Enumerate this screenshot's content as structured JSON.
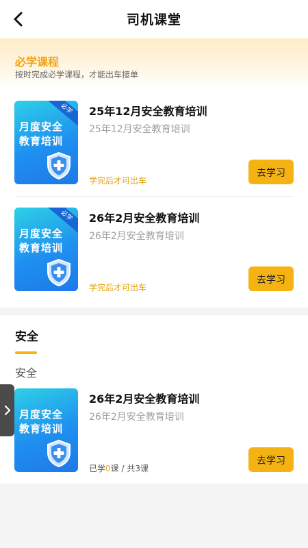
{
  "header": {
    "title": "司机课堂"
  },
  "required": {
    "title": "必学课程",
    "subtitle": "按时完成必学课程，才能出车接单",
    "courses": [
      {
        "thumb_text": "月度安全\n教育培训",
        "badge": "必学",
        "title": "25年12月安全教育培训",
        "subtitle": "25年12月安全教育培训",
        "note": "学完后才可出车",
        "button": "去学习"
      },
      {
        "thumb_text": "月度安全\n教育培训",
        "badge": "必学",
        "title": "26年2月安全教育培训",
        "subtitle": "26年2月安全教育培训",
        "note": "学完后才可出车",
        "button": "去学习"
      }
    ]
  },
  "safety": {
    "tab": "安全",
    "category": "安全",
    "courses": [
      {
        "thumb_text": "月度安全\n教育培训",
        "title": "26年2月安全教育培训",
        "subtitle": "26年2月安全教育培训",
        "progress_prefix": "已学",
        "progress_done": "0",
        "progress_suffix": "课 / 共3课",
        "button": "去学习"
      }
    ]
  },
  "icons": {
    "back": "back-arrow-icon",
    "shield": "shield-cross-icon",
    "expand": "chevron-right-icon"
  },
  "colors": {
    "accent": "#f5b313",
    "accent_text": "#f2a30f",
    "thumb_blue": "#1f8ff0"
  }
}
